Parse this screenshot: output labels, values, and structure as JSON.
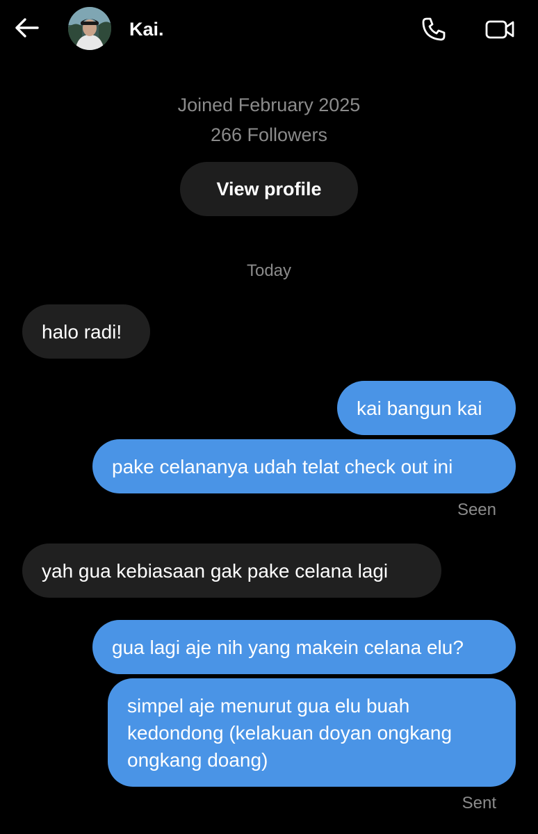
{
  "header": {
    "contact_name": "Kai.",
    "back_icon": "arrow-left-icon",
    "call_icon": "phone-icon",
    "video_icon": "video-camera-icon"
  },
  "profile": {
    "joined": "Joined February 2025",
    "followers": "266 Followers",
    "view_profile_label": "View profile"
  },
  "conversation": {
    "date_separator": "Today",
    "messages": [
      {
        "direction": "received",
        "text": "halo radi!"
      },
      {
        "direction": "sent",
        "text": "kai bangun kai"
      },
      {
        "direction": "sent",
        "text": "pake celananya udah telat check out ini",
        "status": "Seen"
      },
      {
        "direction": "received",
        "text": "yah gua kebiasaan gak pake celana lagi"
      },
      {
        "direction": "sent",
        "text": "gua lagi aje nih yang makein celana elu?"
      },
      {
        "direction": "sent",
        "text": "simpel aje menurut gua elu buah kedondong (kelakuan doyan ongkang ongkang doang)",
        "status": "Sent"
      }
    ]
  },
  "colors": {
    "background": "#000000",
    "sent_bubble": "#4a94e6",
    "received_bubble": "#202020",
    "muted_text": "#8b8b8b"
  }
}
